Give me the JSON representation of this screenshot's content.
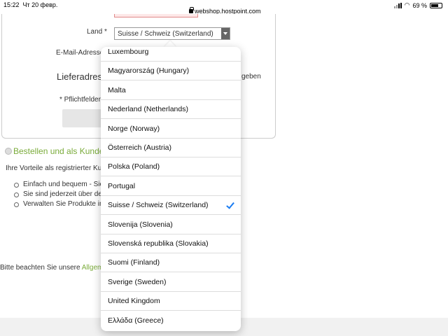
{
  "status_bar": {
    "time": "15:22",
    "date": "Чт 20 февр.",
    "url": "webshop.hostpoint.com",
    "battery": "69 %",
    "battery_level": 0.69
  },
  "form": {
    "land_label": "Land *",
    "land_selected": "Suisse / Schweiz (Switzerland)",
    "email_label": "E-Mail-Adresse",
    "delivery_heading": "Lieferadress",
    "delivery_suffix": "geben",
    "required_note": "* Pflichtfelder"
  },
  "register": {
    "title": "Bestellen und als Kunde",
    "intro": "Ihre Vorteile als registrierter Ku",
    "bullets": [
      "Einfach und bequem - Sie",
      "Sie sind jederzeit über de",
      "Verwalten Sie Produkte in"
    ]
  },
  "footer_note": {
    "text": "Bitte beachten Sie unsere",
    "link": "Allgem"
  },
  "dropdown": {
    "selected": "Suisse / Schweiz (Switzerland)",
    "options": [
      "Luxembourg",
      "Magyarország (Hungary)",
      "Malta",
      "Nederland (Netherlands)",
      "Norge (Norway)",
      "Österreich (Austria)",
      "Polska (Poland)",
      "Portugal",
      "Suisse / Schweiz (Switzerland)",
      "Slovenija (Slovenia)",
      "Slovenská republika (Slovakia)",
      "Suomi (Finland)",
      "Sverige (Sweden)",
      "United Kingdom",
      "Ελλάδα (Greece)"
    ]
  },
  "colors": {
    "accent_green": "#7aab3a",
    "check_blue": "#1a7cf2"
  }
}
